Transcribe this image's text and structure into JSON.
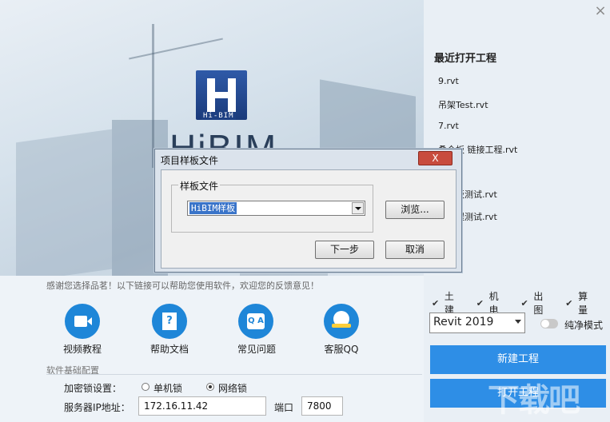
{
  "banner": {
    "logo_sub": "Hi-BIM",
    "big_title": "HiBIM"
  },
  "recent": {
    "title": "最近打开工程",
    "items": [
      "9.rvt",
      "吊架Test.rvt",
      "7.rvt",
      "叠合板 链接工程.rvt",
      "齐梁板测试.rvt",
      "板工程测试.rvt"
    ]
  },
  "disciplines": [
    {
      "label": "土建",
      "checked": true
    },
    {
      "label": "机电",
      "checked": true
    },
    {
      "label": "出图",
      "checked": true
    },
    {
      "label": "算量",
      "checked": true
    }
  ],
  "revit_select": {
    "value": "Revit 2019"
  },
  "pure_mode": {
    "label": "纯净模式",
    "on": false
  },
  "buttons": {
    "new_project": "新建工程",
    "open_project": "打开工程"
  },
  "help": {
    "intro": "感谢您选择品茗！以下链接可以帮助您使用软件，欢迎您的反馈意见！",
    "links": [
      "视频教程",
      "帮助文档",
      "常见问题",
      "客服QQ"
    ]
  },
  "config": {
    "title": "软件基础配置",
    "lock_label": "加密锁设置：",
    "lock_options": [
      "单机锁",
      "网络锁"
    ],
    "lock_selected": "网络锁",
    "server_label": "服务器IP地址：",
    "server_ip": "172.16.11.42",
    "port_label": "端口",
    "port": "7800"
  },
  "dialog": {
    "title": "项目样板文件",
    "close": "X",
    "group_label": "样板文件",
    "template_value": "HiBIM样板",
    "browse": "浏览...",
    "next": "下一步",
    "cancel": "取消"
  },
  "close_icon": "×",
  "watermark": "下载吧"
}
